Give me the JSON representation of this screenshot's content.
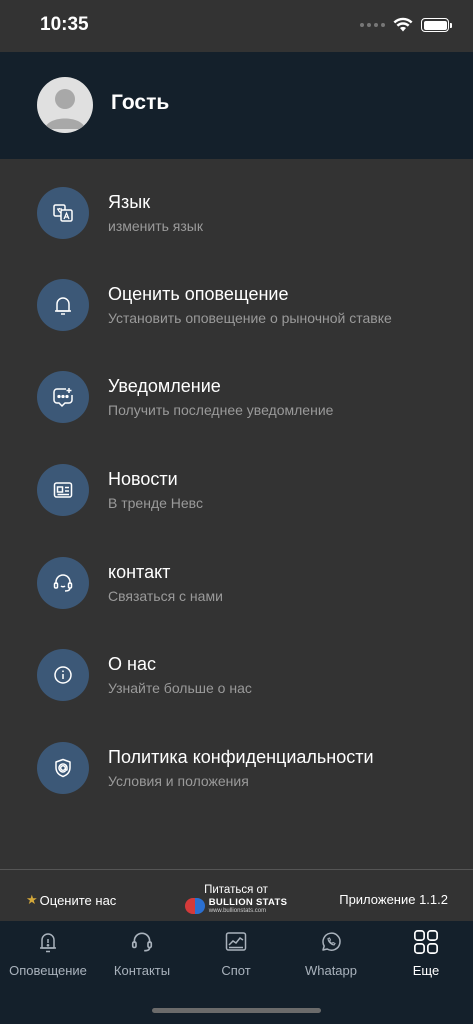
{
  "status_bar": {
    "time": "10:35"
  },
  "profile": {
    "name": "Гость"
  },
  "menu": [
    {
      "id": "language",
      "icon": "translate-icon",
      "title": "Язык",
      "subtitle": "изменить язык"
    },
    {
      "id": "rate-alert",
      "icon": "alert-icon",
      "title": "Оценить оповещение",
      "subtitle": "Установить оповещение о рыночной ставке"
    },
    {
      "id": "notification",
      "icon": "chat-add-icon",
      "title": "Уведомление",
      "subtitle": "Получить последнее уведомление"
    },
    {
      "id": "news",
      "icon": "news-icon",
      "title": "Новости",
      "subtitle": "В тренде Невс"
    },
    {
      "id": "contact",
      "icon": "headset-icon",
      "title": "контакт",
      "subtitle": "Связаться с нами"
    },
    {
      "id": "about",
      "icon": "info-icon",
      "title": "О нас",
      "subtitle": "Узнайте больше о нас"
    },
    {
      "id": "privacy",
      "icon": "shield-icon",
      "title": "Политика конфиденциальности",
      "subtitle": "Условия и положения"
    }
  ],
  "footer": {
    "rate_us": "Оцените нас",
    "powered_by": "Питаться от",
    "logo_name": "BULLION STATS",
    "logo_url": "www.bullionstats.com",
    "app_version": "Приложение 1.1.2"
  },
  "tabs": [
    {
      "id": "alerts",
      "icon": "alert-icon",
      "label": "Оповещение",
      "active": false
    },
    {
      "id": "contacts",
      "icon": "headset-icon",
      "label": "Контакты",
      "active": false
    },
    {
      "id": "spot",
      "icon": "chart-icon",
      "label": "Спот",
      "active": false
    },
    {
      "id": "whatsapp",
      "icon": "whatsapp-icon",
      "label": "Whatapp",
      "active": false
    },
    {
      "id": "more",
      "icon": "grid-icon",
      "label": "Еще",
      "active": true
    }
  ],
  "colors": {
    "background": "#333333",
    "header": "#14202b",
    "icon_circle": "#3c5877",
    "subtitle": "#9a9a9a",
    "star": "#d4a83a"
  }
}
